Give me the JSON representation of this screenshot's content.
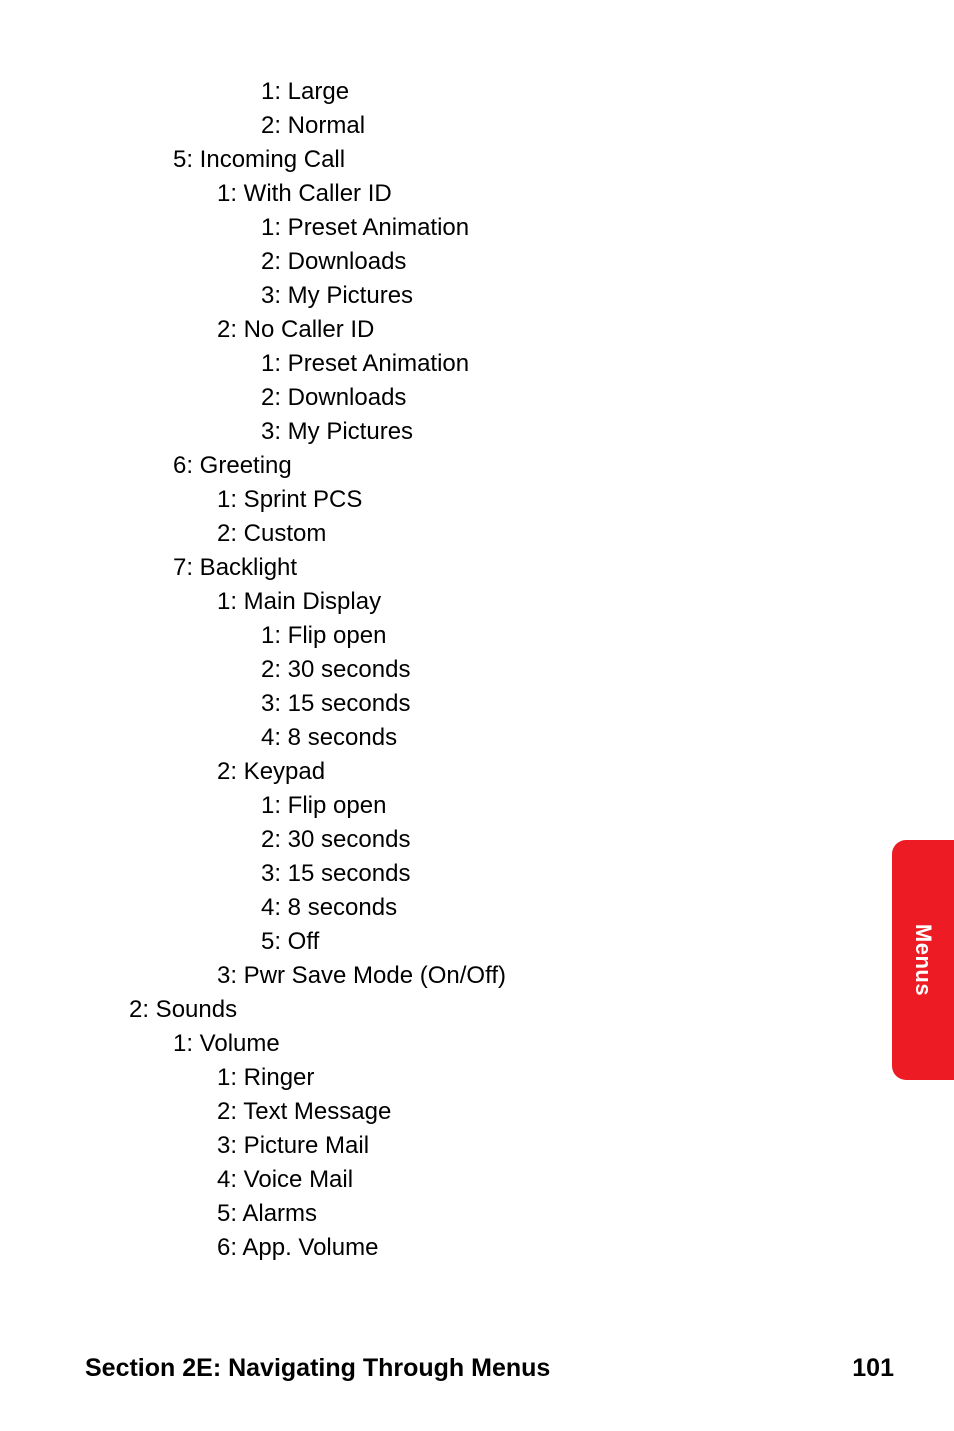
{
  "lines": [
    {
      "indent": 4,
      "text": "1: Large"
    },
    {
      "indent": 4,
      "text": "2: Normal"
    },
    {
      "indent": 2,
      "text": "5: Incoming Call"
    },
    {
      "indent": 3,
      "text": "1: With Caller ID"
    },
    {
      "indent": 4,
      "text": "1: Preset Animation"
    },
    {
      "indent": 4,
      "text": "2: Downloads"
    },
    {
      "indent": 4,
      "text": "3: My Pictures"
    },
    {
      "indent": 3,
      "text": "2: No Caller ID"
    },
    {
      "indent": 4,
      "text": "1: Preset Animation"
    },
    {
      "indent": 4,
      "text": "2: Downloads"
    },
    {
      "indent": 4,
      "text": "3: My Pictures"
    },
    {
      "indent": 2,
      "text": "6: Greeting"
    },
    {
      "indent": 3,
      "text": "1: Sprint PCS"
    },
    {
      "indent": 3,
      "text": "2: Custom"
    },
    {
      "indent": 2,
      "text": "7: Backlight"
    },
    {
      "indent": 3,
      "text": "1: Main Display"
    },
    {
      "indent": 4,
      "text": "1: Flip open"
    },
    {
      "indent": 4,
      "text": "2: 30 seconds"
    },
    {
      "indent": 4,
      "text": "3: 15 seconds"
    },
    {
      "indent": 4,
      "text": "4: 8 seconds"
    },
    {
      "indent": 3,
      "text": "2: Keypad"
    },
    {
      "indent": 4,
      "text": "1: Flip open"
    },
    {
      "indent": 4,
      "text": "2: 30 seconds"
    },
    {
      "indent": 4,
      "text": "3: 15 seconds"
    },
    {
      "indent": 4,
      "text": "4: 8 seconds"
    },
    {
      "indent": 4,
      "text": "5: Off"
    },
    {
      "indent": 3,
      "text": "3: Pwr Save Mode (On/Off)"
    },
    {
      "indent": 1,
      "text": "2: Sounds"
    },
    {
      "indent": 2,
      "text": "1: Volume"
    },
    {
      "indent": 3,
      "text": "1: Ringer"
    },
    {
      "indent": 3,
      "text": "2: Text Message"
    },
    {
      "indent": 3,
      "text": "3: Picture Mail"
    },
    {
      "indent": 3,
      "text": "4: Voice Mail"
    },
    {
      "indent": 3,
      "text": "5: Alarms"
    },
    {
      "indent": 3,
      "text": "6: App. Volume"
    }
  ],
  "sideTab": "Menus",
  "footer": {
    "title": "Section 2E: Navigating Through Menus",
    "page": "101"
  }
}
